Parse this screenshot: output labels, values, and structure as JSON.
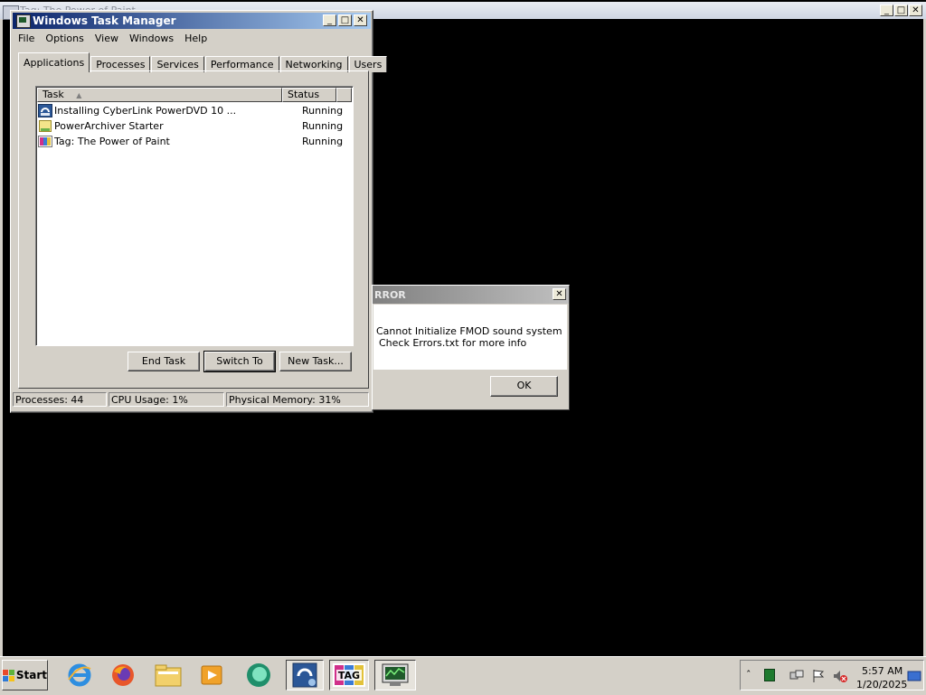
{
  "background_window": {
    "title": "Tag: The Power of Paint"
  },
  "task_manager": {
    "title": "Windows Task Manager",
    "menu": [
      "File",
      "Options",
      "View",
      "Windows",
      "Help"
    ],
    "tabs": [
      "Applications",
      "Processes",
      "Services",
      "Performance",
      "Networking",
      "Users"
    ],
    "active_tab": "Applications",
    "columns": {
      "task": "Task",
      "status": "Status"
    },
    "rows": [
      {
        "task": "Installing CyberLink PowerDVD 10 ...",
        "status": "Running",
        "icon": "cyberlink-installer-icon"
      },
      {
        "task": "PowerArchiver Starter",
        "status": "Running",
        "icon": "powerarchiver-icon"
      },
      {
        "task": "Tag: The Power of Paint",
        "status": "Running",
        "icon": "tag-game-icon"
      }
    ],
    "buttons": {
      "end_task": "End Task",
      "switch_to": "Switch To",
      "new_task": "New Task..."
    },
    "status": {
      "processes": "Processes: 44",
      "cpu": "CPU Usage: 1%",
      "memory": "Physical Memory: 31%"
    }
  },
  "error_dialog": {
    "title": "RROR",
    "line1": "Cannot Initialize FMOD sound system",
    "line2": "Check Errors.txt for more info",
    "ok": "OK"
  },
  "taskbar": {
    "start": "Start",
    "pinned": [
      "internet-explorer-icon",
      "firefox-icon",
      "file-explorer-icon",
      "media-player-icon",
      "chat-app-icon",
      "installer-icon",
      "tag-game-icon",
      "task-manager-icon"
    ],
    "clock_time": "5:57 AM",
    "clock_date": "1/20/2025"
  },
  "colors": {
    "active_title_start": "#0a246a",
    "active_title_end": "#a6caf0",
    "inactive_title_start": "#808080",
    "face": "#d4d0c8",
    "desktop": "#000000"
  }
}
